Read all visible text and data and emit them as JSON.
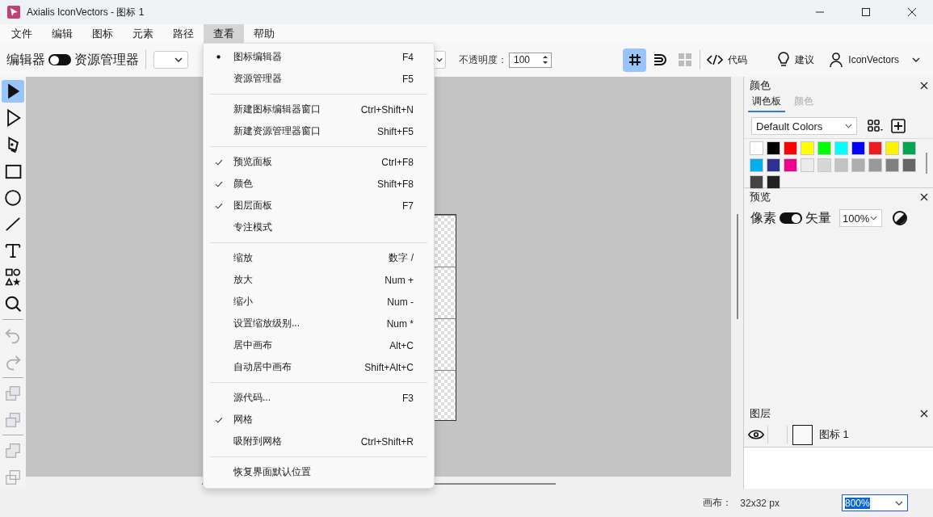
{
  "window": {
    "title": "Axialis IconVectors - 图标 1"
  },
  "menu_bar": [
    {
      "label": "文件",
      "selected": false
    },
    {
      "label": "编辑",
      "selected": false
    },
    {
      "label": "图标",
      "selected": false
    },
    {
      "label": "元素",
      "selected": false
    },
    {
      "label": "路径",
      "selected": false
    },
    {
      "label": "查看",
      "selected": true
    },
    {
      "label": "帮助",
      "selected": false
    }
  ],
  "toolbar": {
    "editor_label": "编辑器",
    "explorer_label": "资源管理器",
    "explorer_mode": false,
    "opacity_label": "不透明度：",
    "opacity_value": "100",
    "grid_on": true,
    "snap_on": false,
    "code": "代码",
    "suggest": "建议",
    "user": "IconVectors"
  },
  "tools": [
    {
      "kind": "select",
      "selected": true,
      "disabled": false
    },
    {
      "kind": "direct",
      "selected": false,
      "disabled": false
    },
    {
      "kind": "pen",
      "selected": false,
      "disabled": false
    },
    {
      "kind": "rect",
      "selected": false,
      "disabled": false
    },
    {
      "kind": "ellipse",
      "selected": false,
      "disabled": false
    },
    {
      "kind": "line",
      "selected": false,
      "disabled": false
    },
    {
      "kind": "text",
      "selected": false,
      "disabled": false
    },
    {
      "kind": "shapes",
      "selected": false,
      "disabled": false
    },
    {
      "kind": "zoom",
      "selected": false,
      "disabled": false
    },
    {
      "kind": "separator"
    },
    {
      "kind": "undo",
      "selected": false,
      "disabled": true
    },
    {
      "kind": "redo",
      "selected": false,
      "disabled": true
    },
    {
      "kind": "separator"
    },
    {
      "kind": "front",
      "selected": false,
      "disabled": true
    },
    {
      "kind": "forward",
      "selected": false,
      "disabled": true
    },
    {
      "kind": "separator"
    },
    {
      "kind": "backward",
      "selected": false,
      "disabled": true
    },
    {
      "kind": "back",
      "selected": false,
      "disabled": true
    }
  ],
  "view_menu": [
    [
      {
        "label": "图标编辑器",
        "shortcut": "F4",
        "kind": "radio",
        "checked": true
      },
      {
        "label": "资源管理器",
        "shortcut": "F5",
        "kind": "radio",
        "checked": false
      }
    ],
    [
      {
        "label": "新建图标编辑器窗口",
        "shortcut": "Ctrl+Shift+N",
        "kind": "command"
      },
      {
        "label": "新建资源管理器窗口",
        "shortcut": "Shift+F5",
        "kind": "command"
      }
    ],
    [
      {
        "label": "预览面板",
        "shortcut": "Ctrl+F8",
        "kind": "toggle",
        "checked": true
      },
      {
        "label": "颜色",
        "shortcut": "Shift+F8",
        "kind": "toggle",
        "checked": true
      },
      {
        "label": "图层面板",
        "shortcut": "F7",
        "kind": "toggle",
        "checked": true
      },
      {
        "label": "专注模式",
        "kind": "toggle",
        "checked": false
      }
    ],
    [
      {
        "label": "缩放",
        "shortcut": "数字 /",
        "kind": "command"
      },
      {
        "label": "放大",
        "shortcut": "Num +",
        "kind": "command"
      },
      {
        "label": "缩小",
        "shortcut": "Num -",
        "kind": "command"
      },
      {
        "label": "设置缩放级别...",
        "shortcut": "Num *",
        "kind": "command"
      },
      {
        "label": "居中画布",
        "shortcut": "Alt+C",
        "kind": "command"
      },
      {
        "label": "自动居中画布",
        "shortcut": "Shift+Alt+C",
        "kind": "command"
      }
    ],
    [
      {
        "label": "源代码...",
        "shortcut": "F3",
        "kind": "command"
      },
      {
        "label": "网格",
        "kind": "toggle",
        "checked": true
      },
      {
        "label": "吸附到网格",
        "shortcut": "Ctrl+Shift+R",
        "kind": "toggle",
        "checked": false
      }
    ],
    [
      {
        "label": "恢复界面默认位置",
        "kind": "command"
      }
    ]
  ],
  "colors_panel": {
    "title": "颜色",
    "tabs": [
      {
        "label": "调色板",
        "selected": true
      },
      {
        "label": "颜色",
        "selected": false
      }
    ],
    "palette": "Default Colors",
    "swatches": [
      {
        "color": "#ffffff"
      },
      {
        "color": "#000000"
      },
      {
        "color": "#ff0000"
      },
      {
        "color": "#ffff00"
      },
      {
        "color": "#00ff00"
      },
      {
        "color": "#00ffff"
      },
      {
        "color": "#0000ff"
      },
      {
        "color": "#ed1c24"
      },
      {
        "color": "#fff200"
      },
      {
        "color": "#00a651"
      },
      {
        "color": "#00aeef"
      },
      {
        "color": "#2e3192"
      },
      {
        "color": "#ec008c"
      },
      {
        "color": "#ebebeb"
      },
      {
        "color": "#d6d6d6"
      },
      {
        "color": "#c2c2c2"
      },
      {
        "color": "#adadad"
      },
      {
        "color": "#999999"
      },
      {
        "color": "#808080"
      },
      {
        "color": "#666666"
      },
      {
        "color": "#444444"
      },
      {
        "color": "#222222"
      }
    ]
  },
  "preview_panel": {
    "title": "预览",
    "pixel_label": "像素",
    "vector_label": "矢量",
    "vector_mode": true,
    "zoom": "100%"
  },
  "layers_panel": {
    "title": "图层",
    "layers": [
      {
        "name": "图标 1",
        "visible": true
      }
    ]
  },
  "status_bar": {
    "canvas_label": "画布：",
    "canvas_size": "32x32 px",
    "zoom": "800%"
  }
}
